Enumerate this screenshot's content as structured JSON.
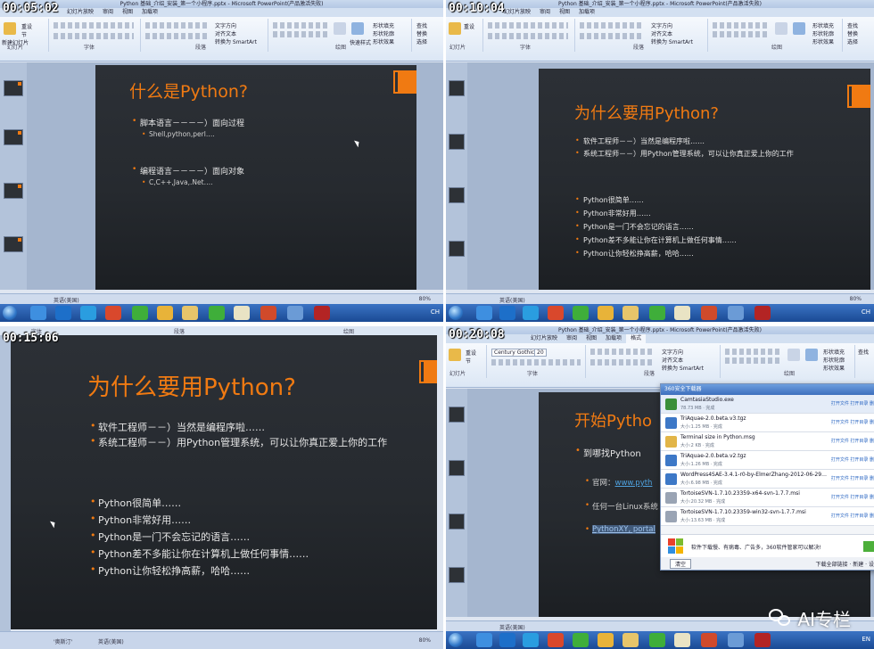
{
  "window": {
    "title_q1": "Python 基础_介绍_安装_第一个小程序.pptx - Microsoft PowerPoint(产品激活失败)",
    "title_q2": "Python 基础_介绍_安装_第一个小程序.pptx - Microsoft PowerPoint(产品激活失败)",
    "title_q4": "Python 基础_介绍_安装_第一个小程序.pptx - Microsoft PowerPoint(产品激活失败)",
    "tabs": [
      "幻灯片放映",
      "审阅",
      "视图",
      "加载项",
      "格式"
    ],
    "ribbon_groups": [
      "幻灯片",
      "字体",
      "段落",
      "绘图",
      "编辑"
    ],
    "font_name": "Century Gothic",
    "font_size": "20",
    "find_label": "查找",
    "replace_label": "替换",
    "select_label": "选择",
    "text_direction": "文字方向",
    "align_text": "对齐文本",
    "smartart": "转换为 SmartArt",
    "arrange": "排列",
    "quick_styles": "快速样式",
    "shape_fill": "形状填充",
    "shape_outline": "形状轮廓",
    "shape_effects": "形状效果",
    "new_slide": "新建幻灯片",
    "reset": "重设",
    "section": "节",
    "status_theme": "'奥斯汀'",
    "status_lang": "英语(美国)",
    "zoom": "80%",
    "tray_lang": "CH",
    "tray_lang_q4": "EN"
  },
  "timestamps": [
    "00:05:02",
    "00:10:04",
    "00:15:06",
    "00:20:08"
  ],
  "slide1": {
    "title": "什么是Python?",
    "b1": "脚本语言－－－－）面向过程",
    "b1_sub": "Shell,python,perl….",
    "b2": "编程语言－－－－）面向对象",
    "b2_sub": "C,C++,Java,.Net…."
  },
  "slide2": {
    "title": "为什么要用Python?",
    "b1": "软件工程师－－）当然是编程序啦……",
    "b2": "系统工程师－－）用Python管理系统，可以让你真正爱上你的工作",
    "b3": "Python很简单……",
    "b4": "Python非常好用……",
    "b5": "Python是一门不会忘记的语言……",
    "b6": "Python差不多能让你在计算机上做任何事情……",
    "b7": "Python让你轻松挣高薪，哈哈……"
  },
  "q3_band": {
    "font": "字体",
    "para": "段落",
    "draw": "绘图"
  },
  "slide4": {
    "title": "开始Pytho",
    "b1": "到哪找Python",
    "s1_label": "官网：",
    "s1_link": "www.pyth",
    "s2": "任何一台Linux系统",
    "s3": "PythonXY, portal"
  },
  "download_manager": {
    "title": "360安全下载器",
    "items": [
      {
        "name": "CamtasiaStudio.exe",
        "size": "78.73 MB · 完成",
        "actions": "打开文件  打开目录  删"
      },
      {
        "name": "TriAquae-2.0.beta.v3.tgz",
        "size": "大小:1.25 MB · 完成",
        "actions": "打开文件  打开目录  删"
      },
      {
        "name": "Terminal size in Python.msg",
        "size": "大小:2 KB · 完成",
        "actions": "打开文件  打开目录  删"
      },
      {
        "name": "TriAquae-2.0.beta.v2.tgz",
        "size": "大小:1.26 MB · 完成",
        "actions": "打开文件  打开目录  删"
      },
      {
        "name": "WordPress4SAE-3.4.1-r0-by-ElmerZhang-2012-06-29…",
        "size": "大小:6.98 MB · 完成",
        "actions": "打开文件  打开目录  删"
      },
      {
        "name": "TortoiseSVN-1.7.10.23359-x64-svn-1.7.7.msi",
        "size": "大小:20.32 MB · 完成",
        "actions": "打开文件  打开目录  删"
      },
      {
        "name": "TortoiseSVN-1.7.10.23359-win32-svn-1.7.7.msi",
        "size": "大小:13.63 MB · 完成",
        "actions": "打开文件  打开目录  删"
      }
    ],
    "promo": "软件下载慢、有病毒、广告多，360软件管家可以解决!",
    "clear_button": "清空",
    "option1": "下载全部链接",
    "option2": "新建",
    "option3": "设"
  },
  "watermark": "AI专栏",
  "colors": {
    "accent": "#f07a12",
    "slide_bg": "#2c3036",
    "ribbon": "#dce7f5",
    "taskbar": "#1a4a94"
  }
}
